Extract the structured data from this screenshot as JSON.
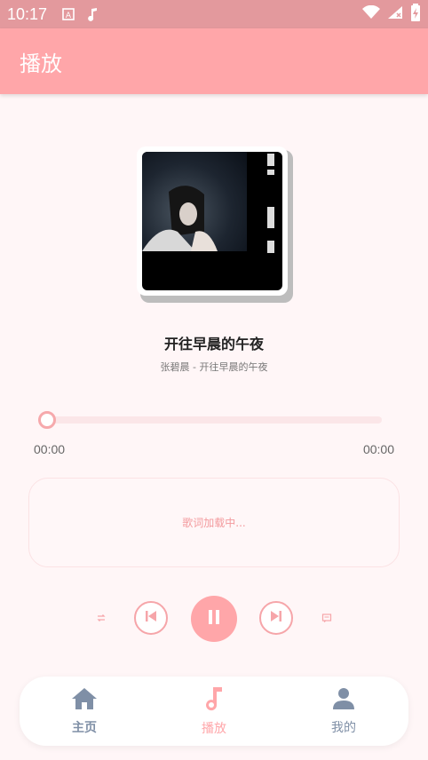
{
  "status_bar": {
    "time": "10:17",
    "icons": [
      "a-icon",
      "music-note-icon",
      "wifi-icon",
      "signal-icon",
      "battery-icon"
    ]
  },
  "app_bar": {
    "title": "播放"
  },
  "now_playing": {
    "title": "开往早晨的午夜",
    "subtitle": "张碧晨 - 开往早晨的午夜",
    "current_time": "00:00",
    "total_time": "00:00",
    "progress": 0
  },
  "lyrics": {
    "status": "歌词加载中..."
  },
  "controls": {
    "icons": [
      "repeat-icon",
      "previous-icon",
      "pause-icon",
      "next-icon",
      "playlist-icon"
    ]
  },
  "bottom_nav": {
    "items": [
      {
        "label": "主页",
        "icon": "home-icon"
      },
      {
        "label": "播放",
        "icon": "music-note-icon"
      },
      {
        "label": "我的",
        "icon": "person-icon"
      }
    ],
    "active_index": 1
  },
  "colors": {
    "accent": "#ffa6a9",
    "status_bar": "#e3999d",
    "nav_inactive": "#7f8fa6",
    "background": "#fff6f7"
  }
}
